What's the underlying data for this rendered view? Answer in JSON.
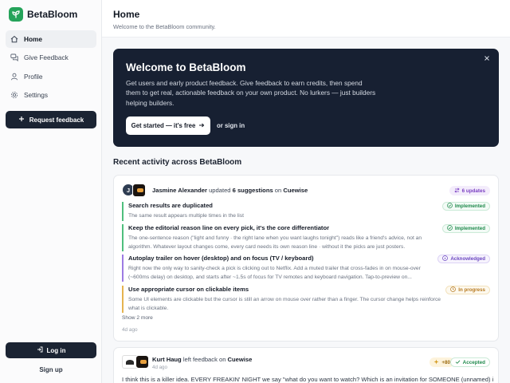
{
  "brand": {
    "name": "BetaBloom",
    "color": "#25a35a"
  },
  "sidebar": {
    "items": [
      {
        "label": "Home",
        "icon": "home-icon",
        "active": true
      },
      {
        "label": "Give Feedback",
        "icon": "chat-icon",
        "active": false
      },
      {
        "label": "Profile",
        "icon": "user-icon",
        "active": false
      },
      {
        "label": "Settings",
        "icon": "gear-icon",
        "active": false
      }
    ],
    "request_label": "Request feedback",
    "login_label": "Log in",
    "signup_label": "Sign up"
  },
  "header": {
    "title": "Home",
    "subtitle": "Welcome to the BetaBloom community."
  },
  "hero": {
    "title": "Welcome to BetaBloom",
    "text": "Get users and early product feedback. Give feedback to earn credits, then spend them to get real, actionable feedback on your own product. No lurkers — just builders helping builders.",
    "cta_label": "Get started — it's free",
    "signin_label": "or sign in"
  },
  "activity": {
    "section_title": "Recent activity across BetaBloom",
    "card1": {
      "avatar_initial": "J",
      "user": "Jasmine Alexander",
      "verb": " updated ",
      "count_text": "6 suggestions",
      "on_text": " on ",
      "product": "Cuewise",
      "updates_label": "6 updates",
      "items": [
        {
          "title": "Search results are duplicated",
          "body": "The same result appears multiple times in the list",
          "status": "Implemented"
        },
        {
          "title": "Keep the editorial reason line on every pick, it's the core differentiator",
          "body": "The one-sentence reason (\"light and funny · the right lane when you want laughs tonight\") reads like a friend's advice, not an algorithm. Whatever layout changes come, every card needs its own reason line · without it the picks are just posters.",
          "status": "Implemented"
        },
        {
          "title": "Autoplay trailer on hover (desktop) and on focus (TV / keyboard)",
          "body": "Right now the only way to sanity-check a pick is clicking out to Netflix. Add a muted trailer that cross-fades in on mouse-over (~600ms delay) on desktop, and starts after ~1.5s of focus for TV remotes and keyboard navigation. Tap-to-preview on...",
          "status": "Acknowledged"
        },
        {
          "title": "Use appropriate cursor on clickable items",
          "body": "Some UI elements are clickable but the cursor is still an arrow on mouse over rather than a finger. The cursor change helps reinforce what is clickable.",
          "status": "In progress"
        }
      ],
      "show_more": "Show 2 more",
      "time": "4d ago"
    },
    "card2": {
      "user": "Kurt Haug",
      "verb": " left feedback on ",
      "product": "Cuewise",
      "time": "4d ago",
      "credits": "+80",
      "status": "Accepted",
      "quote": "I think this is a killer idea. EVERY FREAKIN' NIGHT we say \"what do you want to watch? Which is an invitation for SOMEONE (unnamed) in"
    }
  }
}
